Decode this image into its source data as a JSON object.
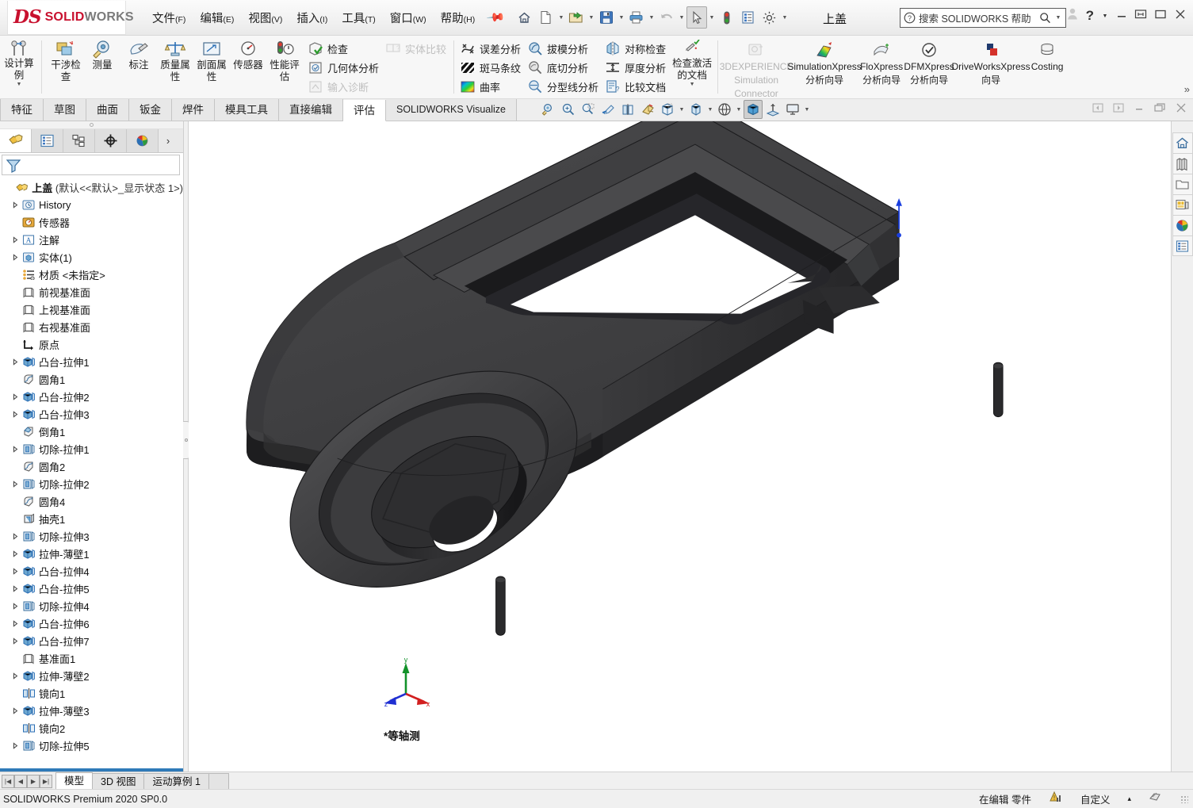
{
  "titlebar": {
    "brand_ds": "DS",
    "brand_solid": "SOLID",
    "brand_works": "WORKS",
    "menus": [
      {
        "label": "文件",
        "key": "(F)"
      },
      {
        "label": "编辑",
        "key": "(E)"
      },
      {
        "label": "视图",
        "key": "(V)"
      },
      {
        "label": "插入",
        "key": "(I)"
      },
      {
        "label": "工具",
        "key": "(T)"
      },
      {
        "label": "窗口",
        "key": "(W)"
      },
      {
        "label": "帮助",
        "key": "(H)"
      }
    ],
    "pin": "pin-icon",
    "quick_access": [
      {
        "name": "home-icon",
        "dropdown": false
      },
      {
        "name": "new-document-icon",
        "dropdown": true
      },
      {
        "name": "open-document-icon",
        "dropdown": true
      },
      {
        "name": "save-icon",
        "dropdown": true
      },
      {
        "name": "print-icon",
        "dropdown": true
      },
      {
        "name": "undo-icon",
        "dropdown": true
      },
      {
        "name": "select-arrow-icon",
        "dropdown": true
      },
      {
        "name": "rebuild-icon",
        "dropdown": false
      },
      {
        "name": "file-properties-icon",
        "dropdown": false
      },
      {
        "name": "options-gear-icon",
        "dropdown": true
      }
    ],
    "document_title": "上盖",
    "search_placeholder": "搜索 SOLIDWORKS 帮助",
    "window_controls": [
      "user-icon",
      "help-icon",
      "minimize-icon",
      "restore-icon",
      "maximize-icon",
      "close-icon"
    ]
  },
  "ribbon": {
    "design_study": {
      "label_lines": [
        "设计算",
        "例"
      ],
      "icon": "design-study-icon"
    },
    "tools": [
      {
        "label_lines": [
          "干涉检",
          "查"
        ],
        "icon": "interference-check-icon"
      },
      {
        "label_lines": [
          "测量"
        ],
        "icon": "measure-icon"
      },
      {
        "label_lines": [
          "标注"
        ],
        "icon": "markup-icon"
      },
      {
        "label_lines": [
          "质量属",
          "性"
        ],
        "icon": "mass-properties-icon"
      },
      {
        "label_lines": [
          "剖面属",
          "性"
        ],
        "icon": "section-properties-icon"
      },
      {
        "label_lines": [
          "传感器"
        ],
        "icon": "sensor-icon"
      },
      {
        "label_lines": [
          "性能评",
          "估"
        ],
        "icon": "performance-evaluation-icon"
      }
    ],
    "column_check": [
      {
        "label": "检查",
        "icon": "check-icon",
        "disabled": false
      },
      {
        "label": "几何体分析",
        "icon": "geometry-analysis-icon",
        "disabled": false
      },
      {
        "label": "输入诊断",
        "icon": "import-diagnostics-icon",
        "disabled": true
      }
    ],
    "column_compare": [
      {
        "label": "实体比较",
        "icon": "compare-bodies-icon",
        "disabled": true
      }
    ],
    "column_deviation": [
      {
        "label": "误差分析",
        "icon": "deviation-analysis-icon",
        "disabled": false
      },
      {
        "label": "斑马条纹",
        "icon": "zebra-stripes-icon",
        "disabled": false
      },
      {
        "label": "曲率",
        "icon": "curvature-icon",
        "disabled": false
      }
    ],
    "column_draft": [
      {
        "label": "拔模分析",
        "icon": "draft-analysis-icon",
        "disabled": false
      },
      {
        "label": "底切分析",
        "icon": "undercut-analysis-icon",
        "disabled": false
      },
      {
        "label": "分型线分析",
        "icon": "parting-line-analysis-icon",
        "disabled": false
      }
    ],
    "column_symmetry": [
      {
        "label": "对称检查",
        "icon": "symmetry-check-icon",
        "disabled": false
      },
      {
        "label": "厚度分析",
        "icon": "thickness-analysis-icon",
        "disabled": false
      },
      {
        "label": "比较文档",
        "icon": "compare-documents-icon",
        "disabled": false
      }
    ],
    "check_active": {
      "label_lines": [
        "检查激活",
        "的文档"
      ],
      "icon": "check-active-document-icon"
    },
    "wizards": [
      {
        "label_lines": [
          "3DEXPERIENCE",
          "Simulation",
          "Connector"
        ],
        "icon": "3dexperience-simulation-icon",
        "disabled": true
      },
      {
        "label_lines": [
          "SimulationXpress",
          "分析向导"
        ],
        "icon": "simulationxpress-icon",
        "disabled": false
      },
      {
        "label_lines": [
          "FloXpress",
          "分析向导"
        ],
        "icon": "floxpress-icon",
        "disabled": false
      },
      {
        "label_lines": [
          "DFMXpress",
          "分析向导"
        ],
        "icon": "dfmxpress-icon",
        "disabled": false
      },
      {
        "label_lines": [
          "DriveWorksXpress",
          "向导"
        ],
        "icon": "driveworksxpress-icon",
        "disabled": false
      },
      {
        "label_lines": [
          "Costing"
        ],
        "icon": "costing-icon",
        "disabled": false
      }
    ],
    "overflow": "»"
  },
  "command_tabs": [
    {
      "label": "特征",
      "active": false
    },
    {
      "label": "草图",
      "active": false
    },
    {
      "label": "曲面",
      "active": false
    },
    {
      "label": "钣金",
      "active": false
    },
    {
      "label": "焊件",
      "active": false
    },
    {
      "label": "模具工具",
      "active": false
    },
    {
      "label": "直接编辑",
      "active": false
    },
    {
      "label": "评估",
      "active": true
    },
    {
      "label": "SOLIDWORKS Visualize",
      "active": false
    }
  ],
  "view_toolbar": [
    {
      "name": "zoom-to-fit-icon",
      "active": false,
      "dropdown": false
    },
    {
      "name": "zoom-to-area-icon",
      "active": false,
      "dropdown": false
    },
    {
      "name": "zoom-in-out-icon",
      "active": false,
      "dropdown": false
    },
    {
      "name": "previous-view-icon",
      "active": false,
      "dropdown": false
    },
    {
      "name": "section-view-icon",
      "active": false,
      "dropdown": false
    },
    {
      "name": "view-orientation-icon",
      "active": false,
      "dropdown": false
    },
    {
      "name": "display-style-icon",
      "active": false,
      "dropdown": true
    },
    {
      "name": "hide-show-items-icon",
      "active": false,
      "dropdown": true
    },
    {
      "name": "edit-appearance-icon",
      "active": false,
      "dropdown": true
    },
    {
      "name": "apply-scene-icon",
      "active": true,
      "dropdown": false
    },
    {
      "name": "view-settings-icon",
      "active": false,
      "dropdown": false
    },
    {
      "name": "viewport-icon",
      "active": false,
      "dropdown": true
    }
  ],
  "mdi_controls": [
    "prev-window-icon",
    "next-window-icon",
    "minimize-window-icon",
    "restore-window-icon",
    "close-window-icon"
  ],
  "feature_manager": {
    "tabs": [
      {
        "name": "feature-manager-tab",
        "active": true
      },
      {
        "name": "property-manager-tab",
        "active": false
      },
      {
        "name": "configuration-manager-tab",
        "active": false
      },
      {
        "name": "dimxpert-manager-tab",
        "active": false
      },
      {
        "name": "display-manager-tab",
        "active": false
      }
    ],
    "more_tabs": "›",
    "filter_icon": "filter-icon",
    "root": {
      "label": "上盖",
      "suffix": "(默认<<默认>_显示状态 1>)",
      "icon": "part-icon"
    },
    "tree": [
      {
        "label": "History",
        "icon": "history-icon",
        "expandable": true,
        "indent": 1
      },
      {
        "label": "传感器",
        "icon": "sensors-icon",
        "expandable": false,
        "indent": 1
      },
      {
        "label": "注解",
        "icon": "annotations-icon",
        "expandable": true,
        "indent": 1
      },
      {
        "label": "实体(1)",
        "icon": "solid-bodies-icon",
        "expandable": true,
        "indent": 1
      },
      {
        "label": "材质 <未指定>",
        "icon": "material-icon",
        "expandable": false,
        "indent": 1
      },
      {
        "label": "前视基准面",
        "icon": "plane-icon",
        "expandable": false,
        "indent": 1
      },
      {
        "label": "上视基准面",
        "icon": "plane-icon",
        "expandable": false,
        "indent": 1
      },
      {
        "label": "右视基准面",
        "icon": "plane-icon",
        "expandable": false,
        "indent": 1
      },
      {
        "label": "原点",
        "icon": "origin-icon",
        "expandable": false,
        "indent": 1
      },
      {
        "label": "凸台-拉伸1",
        "icon": "boss-extrude-icon",
        "expandable": true,
        "indent": 1
      },
      {
        "label": "圆角1",
        "icon": "fillet-icon",
        "expandable": false,
        "indent": 1
      },
      {
        "label": "凸台-拉伸2",
        "icon": "boss-extrude-icon",
        "expandable": true,
        "indent": 1
      },
      {
        "label": "凸台-拉伸3",
        "icon": "boss-extrude-icon",
        "expandable": true,
        "indent": 1
      },
      {
        "label": "倒角1",
        "icon": "chamfer-icon",
        "expandable": false,
        "indent": 1
      },
      {
        "label": "切除-拉伸1",
        "icon": "cut-extrude-icon",
        "expandable": true,
        "indent": 1
      },
      {
        "label": "圆角2",
        "icon": "fillet-icon",
        "expandable": false,
        "indent": 1
      },
      {
        "label": "切除-拉伸2",
        "icon": "cut-extrude-icon",
        "expandable": true,
        "indent": 1
      },
      {
        "label": "圆角4",
        "icon": "fillet-icon",
        "expandable": false,
        "indent": 1
      },
      {
        "label": "抽壳1",
        "icon": "shell-icon",
        "expandable": false,
        "indent": 1
      },
      {
        "label": "切除-拉伸3",
        "icon": "cut-extrude-icon",
        "expandable": true,
        "indent": 1
      },
      {
        "label": "拉伸-薄壁1",
        "icon": "boss-extrude-icon",
        "expandable": true,
        "indent": 1
      },
      {
        "label": "凸台-拉伸4",
        "icon": "boss-extrude-icon",
        "expandable": true,
        "indent": 1
      },
      {
        "label": "凸台-拉伸5",
        "icon": "boss-extrude-icon",
        "expandable": true,
        "indent": 1
      },
      {
        "label": "切除-拉伸4",
        "icon": "cut-extrude-icon",
        "expandable": true,
        "indent": 1
      },
      {
        "label": "凸台-拉伸6",
        "icon": "boss-extrude-icon",
        "expandable": true,
        "indent": 1
      },
      {
        "label": "凸台-拉伸7",
        "icon": "boss-extrude-icon",
        "expandable": true,
        "indent": 1
      },
      {
        "label": "基准面1",
        "icon": "plane-icon",
        "expandable": false,
        "indent": 1
      },
      {
        "label": "拉伸-薄壁2",
        "icon": "boss-extrude-icon",
        "expandable": true,
        "indent": 1
      },
      {
        "label": "镜向1",
        "icon": "mirror-icon",
        "expandable": false,
        "indent": 1
      },
      {
        "label": "拉伸-薄壁3",
        "icon": "boss-extrude-icon",
        "expandable": true,
        "indent": 1
      },
      {
        "label": "镜向2",
        "icon": "mirror-icon",
        "expandable": false,
        "indent": 1
      },
      {
        "label": "切除-拉伸5",
        "icon": "cut-extrude-icon",
        "expandable": true,
        "indent": 1
      }
    ]
  },
  "graphics": {
    "view_label": "*等轴测",
    "triad": {
      "x_label": "x",
      "y_label": "y",
      "z_label": "z",
      "x_color": "#d21f1f",
      "y_color": "#12922a",
      "z_color": "#1f2fd2"
    },
    "model_color": "#3c3c3e",
    "background": "#ffffff",
    "origin_arrow_color": "#1a3fe0"
  },
  "task_pane": [
    {
      "name": "solidworks-resources-icon"
    },
    {
      "name": "design-library-icon"
    },
    {
      "name": "file-explorer-icon"
    },
    {
      "name": "view-palette-icon"
    },
    {
      "name": "appearances-scenes-icon"
    },
    {
      "name": "custom-properties-icon"
    }
  ],
  "bottom_tabs": {
    "nav": [
      "first-icon",
      "prev-icon",
      "next-icon",
      "last-icon"
    ],
    "tabs": [
      {
        "label": "模型",
        "active": true
      },
      {
        "label": "3D 视图",
        "active": false
      },
      {
        "label": "运动算例 1",
        "active": false
      }
    ]
  },
  "status_bar": {
    "left": "SOLIDWORKS Premium 2020 SP0.0",
    "editing": "在编辑 零件",
    "rebuild_icon": "rebuild-status-icon",
    "units": "自定义",
    "units_caret": "▴",
    "overlay_icon": "overlay-icon"
  }
}
